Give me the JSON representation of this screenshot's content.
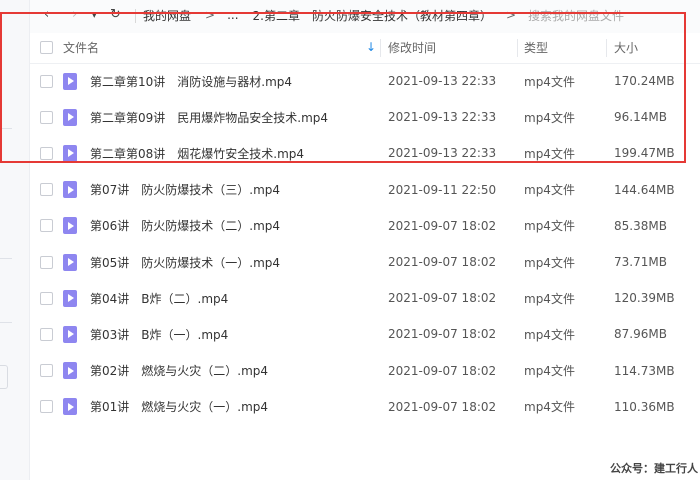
{
  "nav": {
    "breadcrumbs": [
      "我的网盘",
      "...",
      "2.第二章　防火防爆安全技术（教材第四章）"
    ],
    "search_placeholder": "搜索我的网盘文件"
  },
  "table": {
    "columns": {
      "name": "文件名",
      "modified": "修改时间",
      "type": "类型",
      "size": "大小"
    },
    "rows": [
      {
        "name": "第二章第10讲　消防设施与器材.mp4",
        "modified": "2021-09-13 22:33",
        "type": "mp4文件",
        "size": "170.24MB"
      },
      {
        "name": "第二章第09讲　民用爆炸物品安全技术.mp4",
        "modified": "2021-09-13 22:33",
        "type": "mp4文件",
        "size": "96.14MB"
      },
      {
        "name": "第二章第08讲　烟花爆竹安全技术.mp4",
        "modified": "2021-09-13 22:33",
        "type": "mp4文件",
        "size": "199.47MB"
      },
      {
        "name": "第07讲　防火防爆技术（三）.mp4",
        "modified": "2021-09-11 22:50",
        "type": "mp4文件",
        "size": "144.64MB"
      },
      {
        "name": "第06讲　防火防爆技术（二）.mp4",
        "modified": "2021-09-07 18:02",
        "type": "mp4文件",
        "size": "85.38MB"
      },
      {
        "name": "第05讲　防火防爆技术（一）.mp4",
        "modified": "2021-09-07 18:02",
        "type": "mp4文件",
        "size": "73.71MB"
      },
      {
        "name": "第04讲　B炸（二）.mp4",
        "modified": "2021-09-07 18:02",
        "type": "mp4文件",
        "size": "120.39MB"
      },
      {
        "name": "第03讲　B炸（一）.mp4",
        "modified": "2021-09-07 18:02",
        "type": "mp4文件",
        "size": "87.96MB"
      },
      {
        "name": "第02讲　燃烧与火灾（二）.mp4",
        "modified": "2021-09-07 18:02",
        "type": "mp4文件",
        "size": "114.73MB"
      },
      {
        "name": "第01讲　燃烧与火灾（一）.mp4",
        "modified": "2021-09-07 18:02",
        "type": "mp4文件",
        "size": "110.36MB"
      }
    ]
  },
  "watermark": "公众号：建工行人",
  "colors": {
    "highlight": "#e53935",
    "video_icon": "#8e86f0",
    "sort_arrow": "#1e88e5"
  }
}
